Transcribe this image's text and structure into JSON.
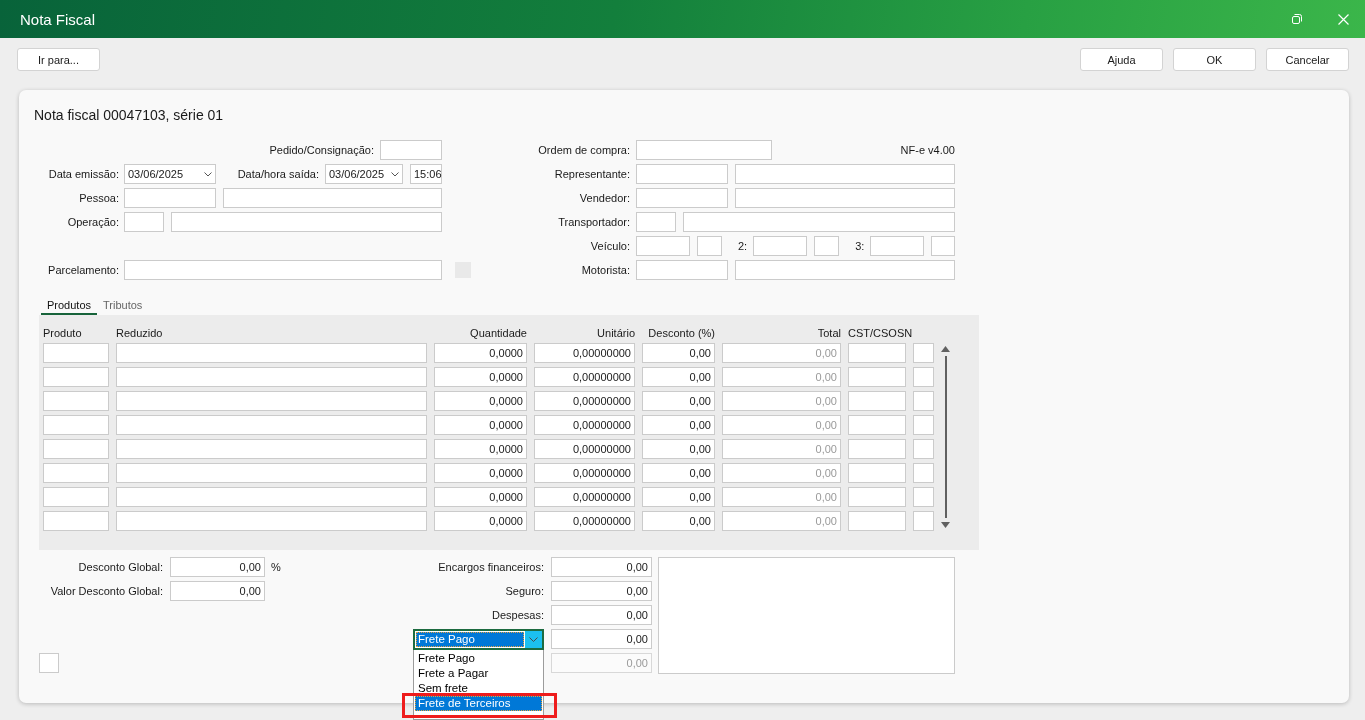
{
  "window": {
    "title": "Nota Fiscal"
  },
  "toolbar": {
    "goto_button": "Ir para...",
    "buttons": [
      "Ajuda",
      "OK",
      "Cancelar"
    ]
  },
  "document": {
    "title": "Nota fiscal 00047103, série 01"
  },
  "left_form": {
    "order": {
      "label": "Pedido/Consignação:"
    },
    "issue_date": {
      "label": "Data emissão:",
      "value": "03/06/2025"
    },
    "exit": {
      "label": "Data/hora saída:",
      "date": "03/06/2025",
      "time": "15:06"
    },
    "person": {
      "label": "Pessoa:"
    },
    "operation": {
      "label": "Operação:"
    },
    "installments": {
      "label": "Parcelamento:",
      "button_disabled": true
    }
  },
  "right_form": {
    "purchase_order": {
      "label": "Ordem de compra:"
    },
    "version": "NF-e v4.00",
    "representative": {
      "label": "Representante:"
    },
    "seller": {
      "label": "Vendedor:"
    },
    "carrier": {
      "label": "Transportador:"
    },
    "vehicles": {
      "label": "Veículo:",
      "second_label": "2:",
      "third_label": "3:"
    },
    "driver": {
      "label": "Motorista:"
    }
  },
  "tabs": [
    {
      "label": "Produtos",
      "selected": true
    },
    {
      "label": "Tributos",
      "selected": false
    }
  ],
  "table": {
    "columns": [
      "Produto",
      "Reduzido",
      "Quantidade",
      "Unitário",
      "Desconto (%)",
      "Total",
      "CST/CSOSN"
    ],
    "totals_disabled": true,
    "rows": [
      {
        "quantity": "0,0000",
        "unit_price": "0,00000000",
        "discount": "0,00",
        "total": "0,00"
      },
      {
        "quantity": "0,0000",
        "unit_price": "0,00000000",
        "discount": "0,00",
        "total": "0,00"
      },
      {
        "quantity": "0,0000",
        "unit_price": "0,00000000",
        "discount": "0,00",
        "total": "0,00"
      },
      {
        "quantity": "0,0000",
        "unit_price": "0,00000000",
        "discount": "0,00",
        "total": "0,00"
      },
      {
        "quantity": "0,0000",
        "unit_price": "0,00000000",
        "discount": "0,00",
        "total": "0,00"
      },
      {
        "quantity": "0,0000",
        "unit_price": "0,00000000",
        "discount": "0,00",
        "total": "0,00"
      },
      {
        "quantity": "0,0000",
        "unit_price": "0,00000000",
        "discount": "0,00",
        "total": "0,00"
      },
      {
        "quantity": "0,0000",
        "unit_price": "0,00000000",
        "discount": "0,00",
        "total": "0,00"
      }
    ]
  },
  "discounts": [
    {
      "label": "Desconto Global:",
      "value": "0,00",
      "unit": "%"
    },
    {
      "label": "Valor Desconto Global:",
      "value": "0,00"
    }
  ],
  "charges": [
    {
      "kind": "field",
      "label": "Encargos financeiros:",
      "value": "0,00",
      "disabled": false
    },
    {
      "kind": "field",
      "label": "Seguro:",
      "value": "0,00",
      "disabled": false
    },
    {
      "kind": "field",
      "label": "Despesas:",
      "value": "0,00",
      "disabled": false
    },
    {
      "kind": "freight",
      "mode": "Frete Pago",
      "open": true,
      "value": "0,00",
      "disabled": false,
      "options": [
        {
          "label": "Frete Pago",
          "selected": false,
          "annotated": false
        },
        {
          "label": "Frete a Pagar",
          "selected": false,
          "annotated": false
        },
        {
          "label": "Sem frete",
          "selected": false,
          "annotated": false
        },
        {
          "label": "Frete de Terceiros",
          "selected": true,
          "annotated": true
        }
      ]
    },
    {
      "kind": "field",
      "value": "0,00",
      "disabled": true
    }
  ]
}
